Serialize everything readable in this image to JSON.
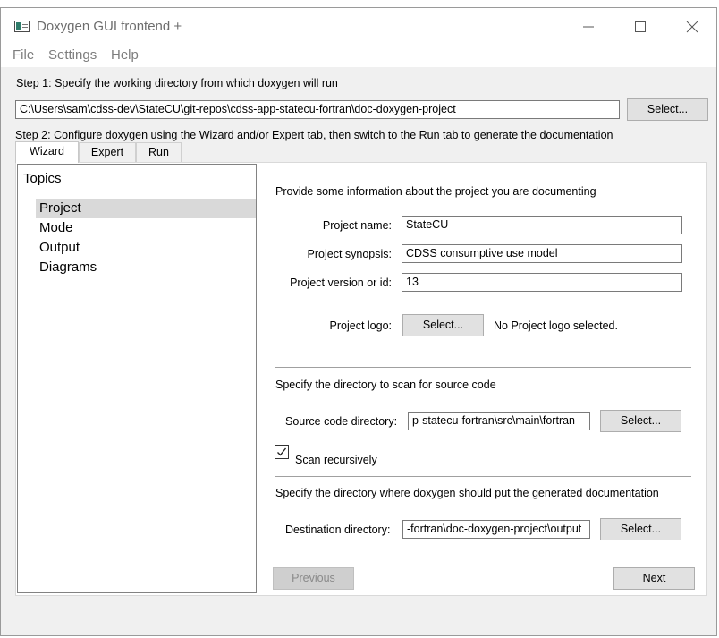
{
  "window": {
    "title": "Doxygen GUI frontend +",
    "controls": [
      "minimize-icon",
      "maximize-icon",
      "close-icon"
    ]
  },
  "menu": {
    "items": [
      "File",
      "Settings",
      "Help"
    ]
  },
  "step1": {
    "label": "Step 1: Specify the working directory from which doxygen will run",
    "directory": "C:\\Users\\sam\\cdss-dev\\StateCU\\git-repos\\cdss-app-statecu-fortran\\doc-doxygen-project",
    "select_label": "Select..."
  },
  "step2": {
    "label": "Step 2: Configure doxygen using the Wizard and/or Expert tab, then switch to the Run tab to generate the documentation"
  },
  "tabs": [
    "Wizard",
    "Expert",
    "Run"
  ],
  "topics": {
    "heading": "Topics",
    "items": [
      "Project",
      "Mode",
      "Output",
      "Diagrams"
    ],
    "selected": "Project"
  },
  "project": {
    "intro": "Provide some information about the project you are documenting",
    "name_label": "Project name:",
    "name_value": "StateCU",
    "synopsis_label": "Project synopsis:",
    "synopsis_value": "CDSS consumptive use model",
    "version_label": "Project version or id:",
    "version_value": "13",
    "logo_label": "Project logo:",
    "logo_button": "Select...",
    "logo_status": "No Project logo selected."
  },
  "source": {
    "intro": "Specify the directory to scan for source code",
    "label": "Source code directory:",
    "value": "p-statecu-fortran\\src\\main\\fortran",
    "select_label": "Select...",
    "scan_recursively_label": "Scan recursively",
    "scan_recursively_checked": true
  },
  "destination": {
    "intro": "Specify the directory where doxygen should put the generated documentation",
    "label": "Destination directory:",
    "value": "-fortran\\doc-doxygen-project\\output",
    "select_label": "Select..."
  },
  "nav": {
    "previous_label": "Previous",
    "next_label": "Next"
  },
  "colors": {
    "window_bg": "#f0f0f0",
    "selected_topic_bg": "#d9d9d9",
    "disabled_button": "#cfcfcf"
  }
}
